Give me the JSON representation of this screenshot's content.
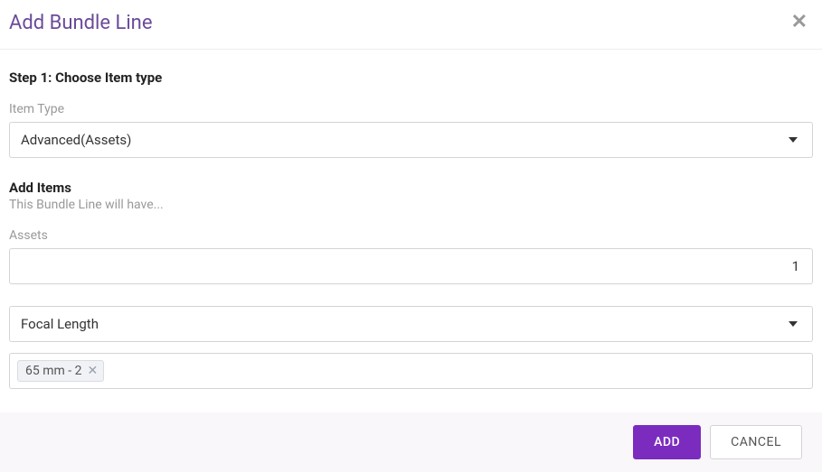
{
  "header": {
    "title": "Add Bundle Line"
  },
  "step1": {
    "heading": "Step 1: Choose Item type",
    "item_type_label": "Item Type",
    "item_type_value": "Advanced(Assets)"
  },
  "add_items": {
    "heading": "Add Items",
    "subheading": "This Bundle Line will have...",
    "assets_label": "Assets",
    "assets_qty": "1",
    "attribute_value": "Focal Length",
    "chip": {
      "label": "65 mm - 2"
    }
  },
  "footer": {
    "add_label": "ADD",
    "cancel_label": "CANCEL"
  }
}
